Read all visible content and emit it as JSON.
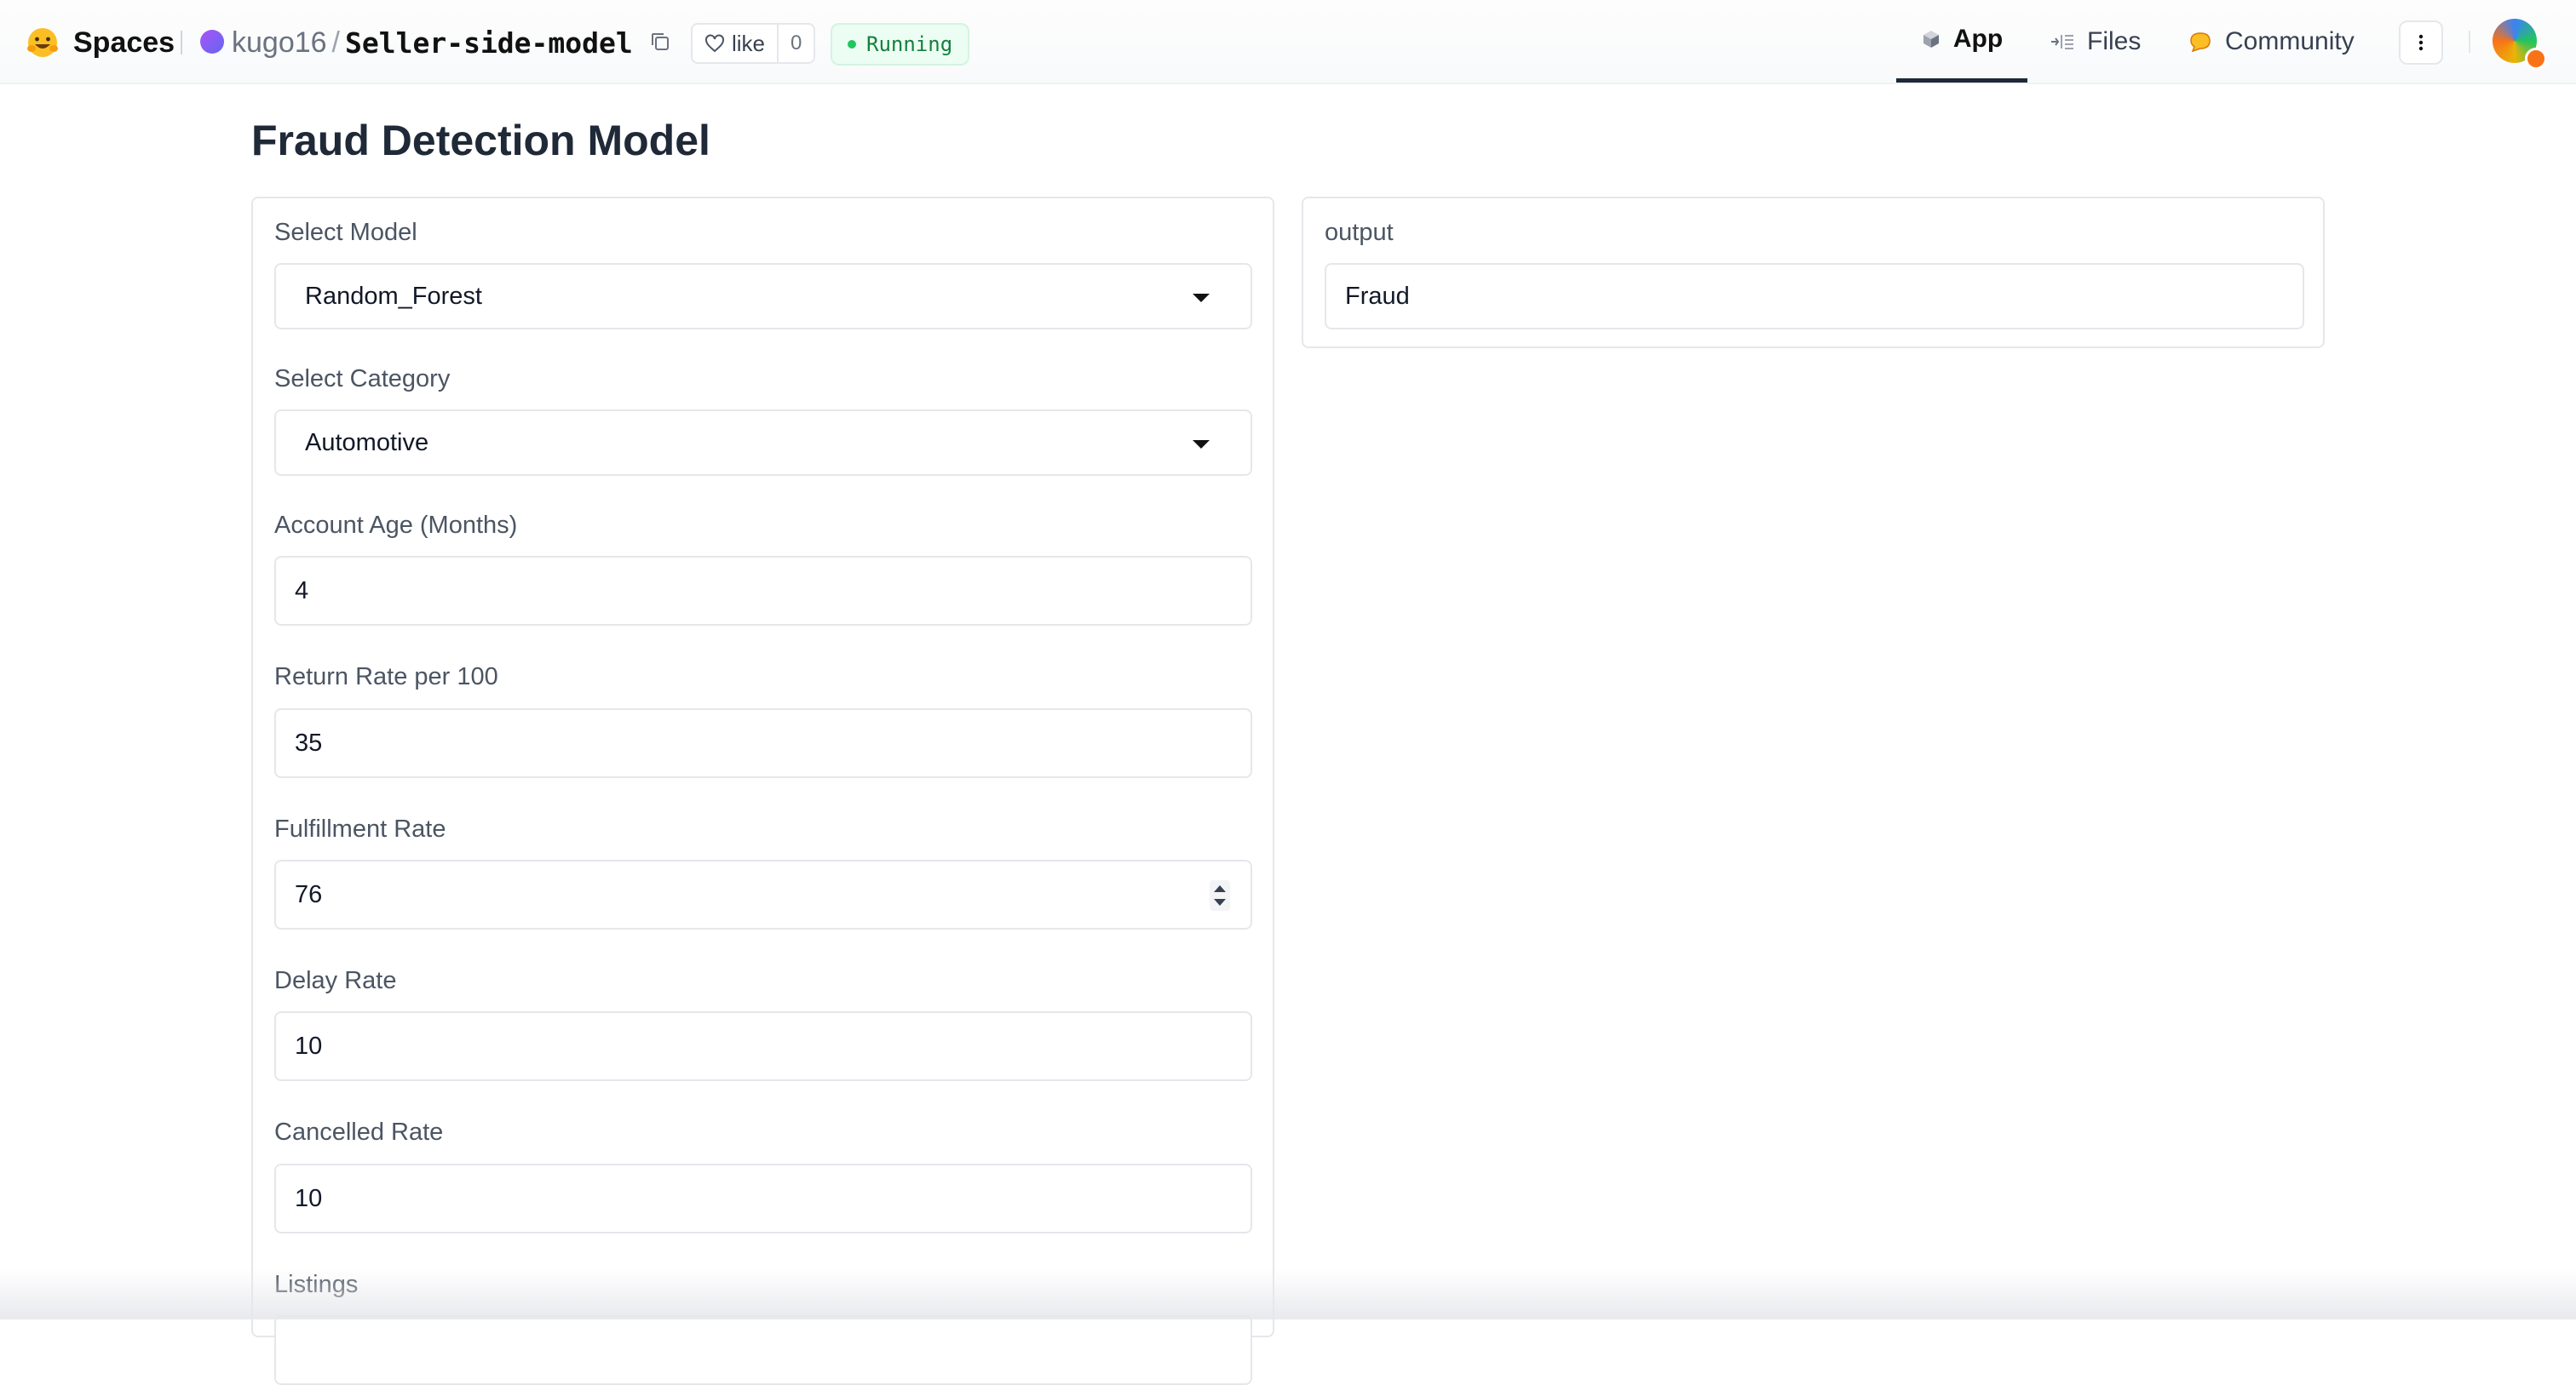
{
  "header": {
    "brand": "Spaces",
    "owner": "kugo16",
    "separator": "/",
    "repo": "Seller-side-model",
    "like_label": "like",
    "like_count": "0",
    "status": "Running",
    "tabs": [
      {
        "label": "App",
        "icon": "cube-icon",
        "active": true
      },
      {
        "label": "Files",
        "icon": "files-icon",
        "active": false
      },
      {
        "label": "Community",
        "icon": "community-icon",
        "active": false
      }
    ]
  },
  "app": {
    "title": "Fraud Detection Model",
    "inputs": {
      "model": {
        "label": "Select Model",
        "value": "Random_Forest"
      },
      "category": {
        "label": "Select Category",
        "value": "Automotive"
      },
      "account_age": {
        "label": "Account Age (Months)",
        "value": "4"
      },
      "return_rate": {
        "label": "Return Rate per 100",
        "value": "35"
      },
      "fulfillment_rate": {
        "label": "Fulfillment Rate",
        "value": "76"
      },
      "delay_rate": {
        "label": "Delay Rate",
        "value": "10"
      },
      "cancelled_rate": {
        "label": "Cancelled Rate",
        "value": "10"
      },
      "listings": {
        "label": "Listings",
        "value": ""
      }
    },
    "output": {
      "label": "output",
      "value": "Fraud"
    }
  },
  "colors": {
    "status_bg": "#ecfdf3",
    "status_text": "#15803d",
    "active_tab_border": "#1f2937",
    "panel_border": "#e5e7eb"
  }
}
